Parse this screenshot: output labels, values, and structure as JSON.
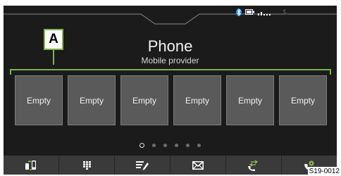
{
  "header": {
    "title": "Phone",
    "subtitle": "Mobile provider"
  },
  "status": {
    "icons": [
      "bluetooth-icon",
      "battery-icon",
      "signal-strength-icon",
      "phone-handset-icon"
    ]
  },
  "annotation": {
    "marker": "A",
    "reference": "S19-0012"
  },
  "favorites": [
    {
      "label": "Empty"
    },
    {
      "label": "Empty"
    },
    {
      "label": "Empty"
    },
    {
      "label": "Empty"
    },
    {
      "label": "Empty"
    },
    {
      "label": "Empty"
    }
  ],
  "pager": {
    "total": 6,
    "current": 1
  },
  "bottom_bar": {
    "buttons": [
      {
        "icon": "phone-selection-icon"
      },
      {
        "icon": "keypad-icon"
      },
      {
        "icon": "contacts-icon"
      },
      {
        "icon": "messages-icon"
      },
      {
        "icon": "call-list-icon"
      },
      {
        "icon": "settings-icon"
      }
    ]
  },
  "colors": {
    "background": "#1b1b1b",
    "tile": "#5a5a5a",
    "bottom_bar": "#3a3a3a",
    "annotation_green": "#7ab648",
    "bluetooth_blue": "#1e90ff",
    "accent_green": "#8bc34a"
  }
}
